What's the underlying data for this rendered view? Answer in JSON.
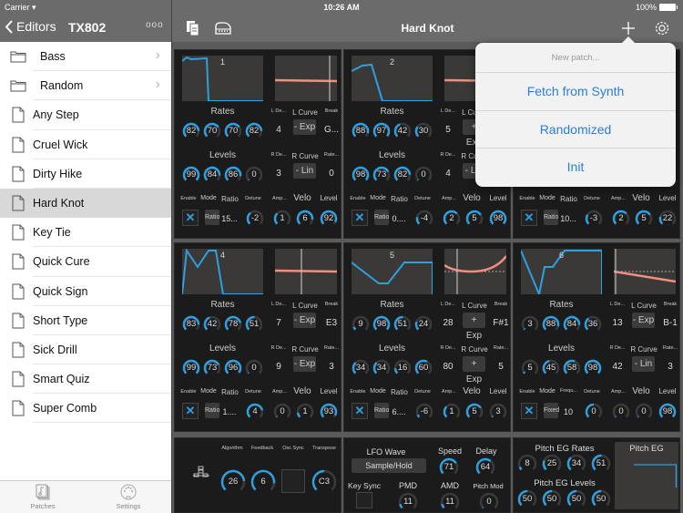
{
  "status_bar": {
    "carrier": "Carrier",
    "time": "10:26 AM",
    "battery": "100%"
  },
  "sidebar_nav": {
    "back_label": "Editors",
    "title": "TX802",
    "more": "ooo"
  },
  "main_nav": {
    "title": "Hard Knot"
  },
  "sidebar": {
    "items": [
      {
        "label": "Bass",
        "type": "folder"
      },
      {
        "label": "Random",
        "type": "folder"
      },
      {
        "label": "Any Step",
        "type": "patch"
      },
      {
        "label": "Cruel Wick",
        "type": "patch"
      },
      {
        "label": "Dirty Hike",
        "type": "patch"
      },
      {
        "label": "Hard Knot",
        "type": "patch",
        "selected": true
      },
      {
        "label": "Key Tie",
        "type": "patch"
      },
      {
        "label": "Quick Cure",
        "type": "patch"
      },
      {
        "label": "Quick Sign",
        "type": "patch"
      },
      {
        "label": "Short Type",
        "type": "patch"
      },
      {
        "label": "Sick Drill",
        "type": "patch"
      },
      {
        "label": "Smart Quiz",
        "type": "patch"
      },
      {
        "label": "Super Comb",
        "type": "patch"
      }
    ]
  },
  "tabbar": {
    "tabs": [
      {
        "label": "Patches"
      },
      {
        "label": "Settings"
      }
    ]
  },
  "labels": {
    "rates": "Rates",
    "levels": "Levels",
    "l_depth": "L De...",
    "l_curve": "L Curve",
    "break": "Break",
    "r_depth": "R De...",
    "r_curve": "R Curve",
    "rate_scale": "Rate...",
    "enable": "Enable",
    "mode": "Mode",
    "ratio": "Ratio",
    "freq": "Frequ...",
    "detune": "Detune",
    "amp": "Amp...",
    "velo": "Velo",
    "level": "Level"
  },
  "accent_color": "#2e9fdf",
  "operators": [
    {
      "num": "1",
      "rates": [
        82,
        70,
        70,
        82
      ],
      "levels": [
        99,
        84,
        86,
        0
      ],
      "l_depth": "4",
      "l_curve": "- Exp",
      "break": "G...",
      "r_depth": "3",
      "r_curve": "- Lin",
      "rate_scale": "0",
      "enabled": true,
      "mode": "Ratio",
      "ratio_label": "Ratio",
      "ratio": "15...",
      "detune": -2,
      "amp": 1,
      "velo": 6,
      "level": 92
    },
    {
      "num": "2",
      "rates": [
        88,
        97,
        42,
        30
      ],
      "levels": [
        98,
        73,
        82,
        0
      ],
      "l_depth": "5",
      "l_curve": "+ Exp",
      "break": "",
      "r_depth": "4",
      "r_curve": "- Lin",
      "rate_scale": "",
      "enabled": true,
      "mode": "Ratio",
      "ratio_label": "Ratio",
      "ratio": "0....",
      "detune": -4,
      "amp": 2,
      "velo": 5,
      "level": 98
    },
    {
      "num": "3",
      "rates": [],
      "levels": [],
      "l_depth": "",
      "l_curve": "",
      "break": "",
      "r_depth": "",
      "r_curve": "",
      "rate_scale": "",
      "enabled": true,
      "mode": "Ratio",
      "ratio_label": "Ratio",
      "ratio": "10...",
      "detune": -3,
      "amp": 2,
      "velo": 5,
      "level": 22
    },
    {
      "num": "4",
      "rates": [
        83,
        42,
        78,
        51
      ],
      "levels": [
        99,
        73,
        96,
        0
      ],
      "l_depth": "7",
      "l_curve": "- Exp",
      "break": "E3",
      "r_depth": "9",
      "r_curve": "- Exp",
      "rate_scale": "3",
      "enabled": true,
      "mode": "Ratio",
      "ratio_label": "Ratio",
      "ratio": "1....",
      "detune": 4,
      "amp": 0,
      "velo": 1,
      "level": 93
    },
    {
      "num": "5",
      "rates": [
        9,
        98,
        51,
        24
      ],
      "levels": [
        34,
        34,
        16,
        60
      ],
      "l_depth": "28",
      "l_curve": "+ Exp",
      "break": "F#1",
      "r_depth": "80",
      "r_curve": "+ Exp",
      "rate_scale": "5",
      "enabled": true,
      "mode": "Ratio",
      "ratio_label": "Ratio",
      "ratio": "6....",
      "detune": -6,
      "amp": 1,
      "velo": 5,
      "level": 3
    },
    {
      "num": "6",
      "rates": [
        3,
        88,
        84,
        36
      ],
      "levels": [
        5,
        45,
        58,
        98
      ],
      "l_depth": "13",
      "l_curve": "- Exp",
      "break": "B-1",
      "r_depth": "42",
      "r_curve": "- Lin",
      "rate_scale": "3",
      "enabled": true,
      "mode": "Fixed",
      "ratio_label": "Frequ...",
      "ratio": "10",
      "detune": 0,
      "amp": 0,
      "velo": 0,
      "level": 98
    }
  ],
  "global": {
    "algorithm_label": "Algorithm",
    "algorithm": "26",
    "feedback_label": "Feedback",
    "feedback": "6",
    "osc_sync_label": "Osc Sync",
    "osc_sync": false,
    "transpose_label": "Transpose",
    "transpose": "C3"
  },
  "lfo": {
    "wave_label": "LFO Wave",
    "wave": "Sample/Hold",
    "speed_label": "Speed",
    "speed": "71",
    "delay_label": "Delay",
    "delay": "64",
    "key_sync_label": "Key Sync",
    "key_sync": false,
    "pmd_label": "PMD",
    "pmd": "11",
    "amd_label": "AMD",
    "amd": "11",
    "pitch_mod_label": "Pitch Mod",
    "pitch_mod": "0"
  },
  "pitch_eg": {
    "rates_label": "Pitch EG Rates",
    "rates": [
      8,
      25,
      34,
      51
    ],
    "levels_label": "Pitch EG Levels",
    "levels": [
      50,
      50,
      50,
      50
    ],
    "graph_label": "Pitch EG"
  },
  "popover": {
    "header": "New patch...",
    "items": [
      "Fetch from Synth",
      "Randomized",
      "Init"
    ]
  }
}
